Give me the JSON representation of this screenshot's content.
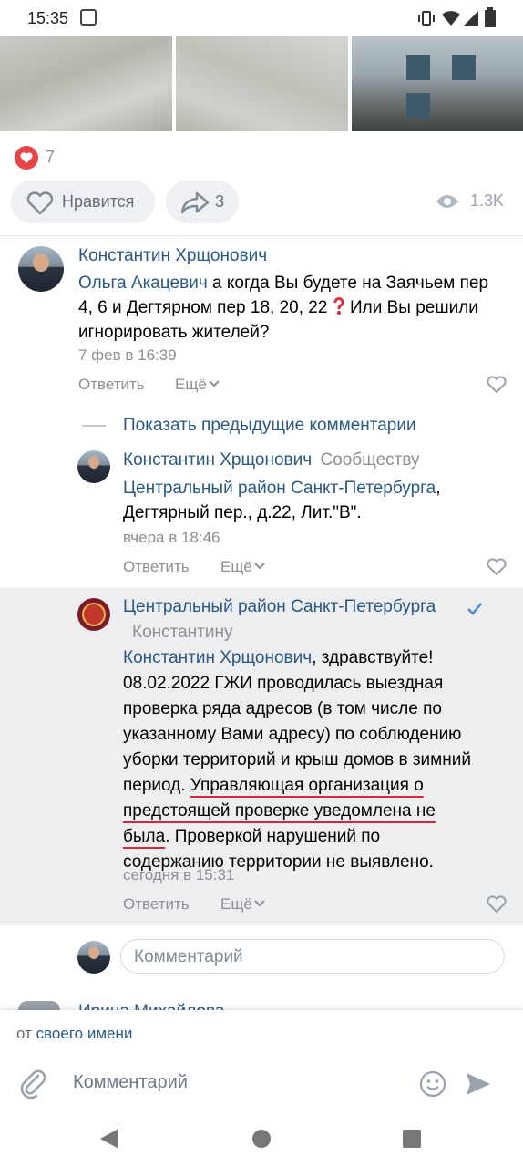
{
  "status": {
    "time": "15:35"
  },
  "post": {
    "like_count": "7",
    "like_button_label": "Нравится",
    "share_count": "3",
    "views": "1.3K"
  },
  "comment1": {
    "author": "Константин Хрщонович",
    "reply_to": "Ольга Акацевич",
    "text": " а когда Вы будете на Заячьем пер 4, 6 и Дегтярном пер 18, 20, 22",
    "text2": " Или Вы решили игнорировать жителей?",
    "date": "7 фев в 16:39",
    "reply_label": "Ответить",
    "more_label": "Ещё"
  },
  "show_prev": "Показать предыдущие комментарии",
  "reply1": {
    "author": "Константин Хрщонович",
    "to": "Сообществу",
    "mention": "Центральный район Санкт-Петербурга",
    "text": "Дегтярный пер., д.22, Лит.\"В\".",
    "date": "вчера в 18:46",
    "reply_label": "Ответить",
    "more_label": "Ещё"
  },
  "reply2": {
    "author": "Центральный район Санкт-Петербурга",
    "to": "Константину",
    "mention": "Константин Хрщонович",
    "greeting": ", здравствуйте!",
    "line1": "08.02.2022 ГЖИ проводилась выездная",
    "line2": "проверка ряда адресов (в том числе по",
    "line3": "указанному Вами адресу) по соблюдению",
    "line4": "уборки территорий и крыш домов в зимний",
    "line5a": "период. ",
    "line5b": "Управляющая организация о",
    "line6": "предстоящей проверке уведомлена не",
    "line7a": "была",
    "line7b": ". Проверкой нарушений по",
    "line8": "содержанию территории не выявлено.",
    "date": "сегодня в 15:31",
    "reply_label": "Ответить",
    "more_label": "Ещё"
  },
  "comment_input_placeholder": "Комментарий",
  "next_author_partial": "Ирина Михайлова",
  "composer": {
    "from_prefix": "от ",
    "from_link": "своего имени",
    "placeholder": "Комментарий"
  },
  "colors": {
    "accent": "#2a5885",
    "like": "#e64646",
    "highlight_bg": "#edeef0",
    "underline": "#d9263a"
  }
}
